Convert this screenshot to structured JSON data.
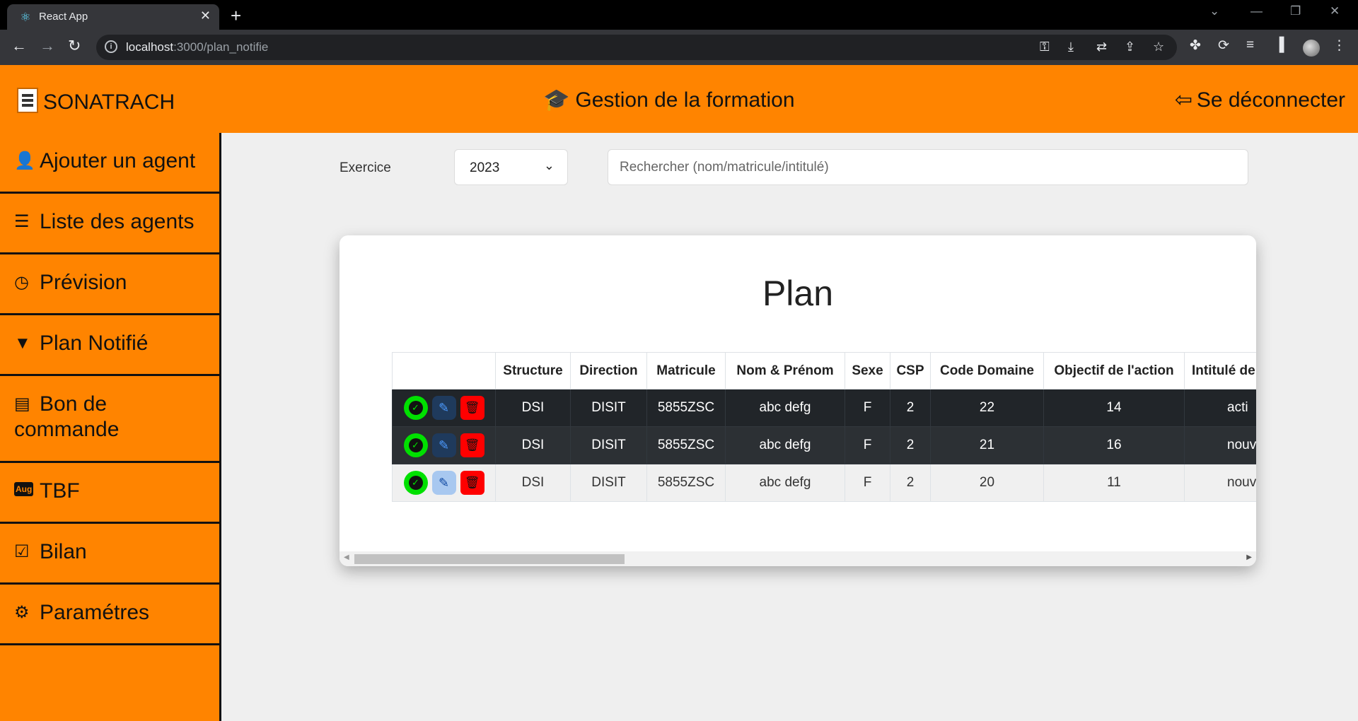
{
  "browser": {
    "tab_title": "React App",
    "url_host": "localhost",
    "url_path": ":3000/plan_notifie"
  },
  "header": {
    "brand": "SONATRACH",
    "title": "Gestion de la formation",
    "logout": "Se déconnecter"
  },
  "sidebar": {
    "items": [
      {
        "label": "Ajouter un agent",
        "icon": "user-plus-icon"
      },
      {
        "label": "Liste des agents",
        "icon": "user-list-icon"
      },
      {
        "label": "Prévision",
        "icon": "clock-icon"
      },
      {
        "label": "Plan Notifié",
        "icon": "bookmark-icon"
      },
      {
        "label": "Bon de commande",
        "icon": "receipt-icon"
      },
      {
        "label": "TBF",
        "icon": "calendar-aug-icon",
        "badge": "Aug"
      },
      {
        "label": "Bilan",
        "icon": "calendar-check-icon"
      },
      {
        "label": "Paramétres",
        "icon": "gear-icon"
      }
    ]
  },
  "filters": {
    "exercise_label": "Exercice",
    "year": "2023",
    "search_placeholder": "Rechercher (nom/matricule/intitulé)"
  },
  "plan": {
    "title": "Plan",
    "columns": [
      "",
      "Structure",
      "Direction",
      "Matricule",
      "Nom & Prénom",
      "Sexe",
      "CSP",
      "Code Domaine",
      "Objectif de l'action",
      "Intitulé de"
    ],
    "rows": [
      {
        "structure": "DSI",
        "direction": "DISIT",
        "matricule": "5855ZSC",
        "nom": "abc defg",
        "sexe": "F",
        "csp": "2",
        "code_domaine": "22",
        "objectif": "14",
        "intitule": "acti"
      },
      {
        "structure": "DSI",
        "direction": "DISIT",
        "matricule": "5855ZSC",
        "nom": "abc defg",
        "sexe": "F",
        "csp": "2",
        "code_domaine": "21",
        "objectif": "16",
        "intitule": "nouv"
      },
      {
        "structure": "DSI",
        "direction": "DISIT",
        "matricule": "5855ZSC",
        "nom": "abc defg",
        "sexe": "F",
        "csp": "2",
        "code_domaine": "20",
        "objectif": "11",
        "intitule": "nouv"
      }
    ]
  },
  "colors": {
    "accent": "#ff8400",
    "approve": "#00e000",
    "delete": "#ff0000",
    "dark_row": "#212529"
  }
}
